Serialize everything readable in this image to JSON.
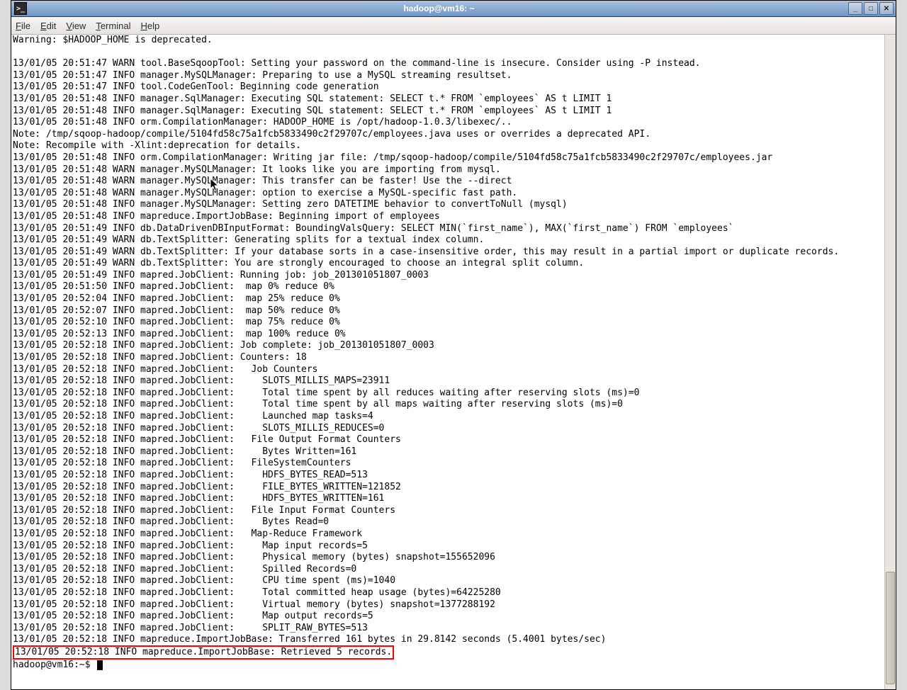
{
  "window": {
    "title": "hadoop@vm16: ~",
    "icon_glyph": ">_"
  },
  "menu": {
    "file": "File",
    "edit": "Edit",
    "view": "View",
    "terminal": "Terminal",
    "help": "Help"
  },
  "win_buttons": {
    "min": "_",
    "max": "□",
    "close": "✕"
  },
  "prompt": "hadoop@vm16:~$ ",
  "highlight_line": "13/01/05 20:52:18 INFO mapreduce.ImportJobBase: Retrieved 5 records.",
  "lines": [
    "Warning: $HADOOP_HOME is deprecated.",
    "",
    "13/01/05 20:51:47 WARN tool.BaseSqoopTool: Setting your password on the command-line is insecure. Consider using -P instead.",
    "13/01/05 20:51:47 INFO manager.MySQLManager: Preparing to use a MySQL streaming resultset.",
    "13/01/05 20:51:47 INFO tool.CodeGenTool: Beginning code generation",
    "13/01/05 20:51:48 INFO manager.SqlManager: Executing SQL statement: SELECT t.* FROM `employees` AS t LIMIT 1",
    "13/01/05 20:51:48 INFO manager.SqlManager: Executing SQL statement: SELECT t.* FROM `employees` AS t LIMIT 1",
    "13/01/05 20:51:48 INFO orm.CompilationManager: HADOOP_HOME is /opt/hadoop-1.0.3/libexec/..",
    "Note: /tmp/sqoop-hadoop/compile/5104fd58c75a1fcb5833490c2f29707c/employees.java uses or overrides a deprecated API.",
    "Note: Recompile with -Xlint:deprecation for details.",
    "13/01/05 20:51:48 INFO orm.CompilationManager: Writing jar file: /tmp/sqoop-hadoop/compile/5104fd58c75a1fcb5833490c2f29707c/employees.jar",
    "13/01/05 20:51:48 WARN manager.MySQLManager: It looks like you are importing from mysql.",
    "13/01/05 20:51:48 WARN manager.MySQLManager: This transfer can be faster! Use the --direct",
    "13/01/05 20:51:48 WARN manager.MySQLManager: option to exercise a MySQL-specific fast path.",
    "13/01/05 20:51:48 INFO manager.MySQLManager: Setting zero DATETIME behavior to convertToNull (mysql)",
    "13/01/05 20:51:48 INFO mapreduce.ImportJobBase: Beginning import of employees",
    "13/01/05 20:51:49 INFO db.DataDrivenDBInputFormat: BoundingValsQuery: SELECT MIN(`first_name`), MAX(`first_name`) FROM `employees`",
    "13/01/05 20:51:49 WARN db.TextSplitter: Generating splits for a textual index column.",
    "13/01/05 20:51:49 WARN db.TextSplitter: If your database sorts in a case-insensitive order, this may result in a partial import or duplicate records.",
    "13/01/05 20:51:49 WARN db.TextSplitter: You are strongly encouraged to choose an integral split column.",
    "13/01/05 20:51:49 INFO mapred.JobClient: Running job: job_201301051807_0003",
    "13/01/05 20:51:50 INFO mapred.JobClient:  map 0% reduce 0%",
    "13/01/05 20:52:04 INFO mapred.JobClient:  map 25% reduce 0%",
    "13/01/05 20:52:07 INFO mapred.JobClient:  map 50% reduce 0%",
    "13/01/05 20:52:10 INFO mapred.JobClient:  map 75% reduce 0%",
    "13/01/05 20:52:13 INFO mapred.JobClient:  map 100% reduce 0%",
    "13/01/05 20:52:18 INFO mapred.JobClient: Job complete: job_201301051807_0003",
    "13/01/05 20:52:18 INFO mapred.JobClient: Counters: 18",
    "13/01/05 20:52:18 INFO mapred.JobClient:   Job Counters ",
    "13/01/05 20:52:18 INFO mapred.JobClient:     SLOTS_MILLIS_MAPS=23911",
    "13/01/05 20:52:18 INFO mapred.JobClient:     Total time spent by all reduces waiting after reserving slots (ms)=0",
    "13/01/05 20:52:18 INFO mapred.JobClient:     Total time spent by all maps waiting after reserving slots (ms)=0",
    "13/01/05 20:52:18 INFO mapred.JobClient:     Launched map tasks=4",
    "13/01/05 20:52:18 INFO mapred.JobClient:     SLOTS_MILLIS_REDUCES=0",
    "13/01/05 20:52:18 INFO mapred.JobClient:   File Output Format Counters ",
    "13/01/05 20:52:18 INFO mapred.JobClient:     Bytes Written=161",
    "13/01/05 20:52:18 INFO mapred.JobClient:   FileSystemCounters",
    "13/01/05 20:52:18 INFO mapred.JobClient:     HDFS_BYTES_READ=513",
    "13/01/05 20:52:18 INFO mapred.JobClient:     FILE_BYTES_WRITTEN=121852",
    "13/01/05 20:52:18 INFO mapred.JobClient:     HDFS_BYTES_WRITTEN=161",
    "13/01/05 20:52:18 INFO mapred.JobClient:   File Input Format Counters ",
    "13/01/05 20:52:18 INFO mapred.JobClient:     Bytes Read=0",
    "13/01/05 20:52:18 INFO mapred.JobClient:   Map-Reduce Framework",
    "13/01/05 20:52:18 INFO mapred.JobClient:     Map input records=5",
    "13/01/05 20:52:18 INFO mapred.JobClient:     Physical memory (bytes) snapshot=155652096",
    "13/01/05 20:52:18 INFO mapred.JobClient:     Spilled Records=0",
    "13/01/05 20:52:18 INFO mapred.JobClient:     CPU time spent (ms)=1040",
    "13/01/05 20:52:18 INFO mapred.JobClient:     Total committed heap usage (bytes)=64225280",
    "13/01/05 20:52:18 INFO mapred.JobClient:     Virtual memory (bytes) snapshot=1377288192",
    "13/01/05 20:52:18 INFO mapred.JobClient:     Map output records=5",
    "13/01/05 20:52:18 INFO mapred.JobClient:     SPLIT_RAW_BYTES=513",
    "13/01/05 20:52:18 INFO mapreduce.ImportJobBase: Transferred 161 bytes in 29.8142 seconds (5.4001 bytes/sec)"
  ]
}
